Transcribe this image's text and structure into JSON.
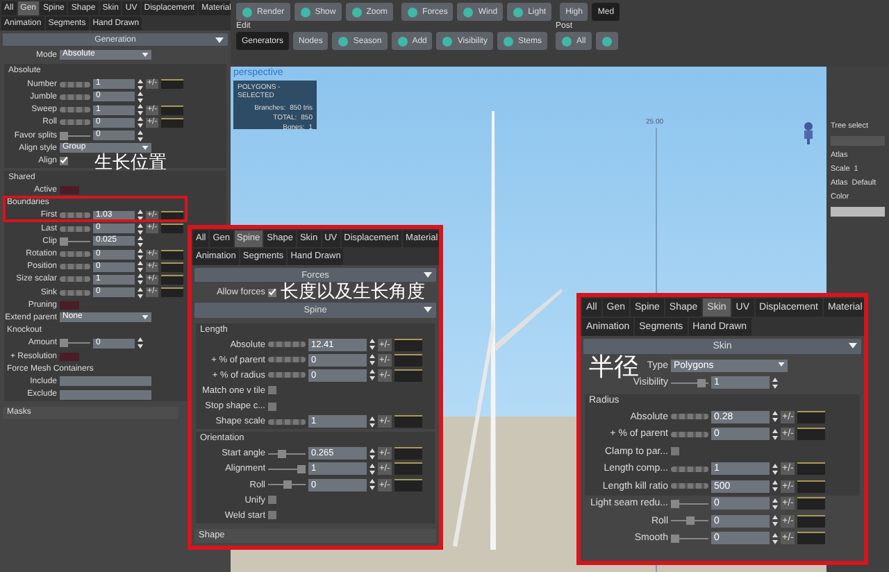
{
  "panels": [
    {
      "highlighted": false,
      "tabs": [
        [
          {
            "label": "All",
            "selected": false
          },
          {
            "label": "Gen",
            "selected": true
          },
          {
            "label": "Spine",
            "selected": false
          },
          {
            "label": "Shape",
            "selected": false
          },
          {
            "label": "Skin",
            "selected": false
          },
          {
            "label": "UV",
            "selected": false
          },
          {
            "label": "Displacement",
            "selected": false
          },
          {
            "label": "Material",
            "selected": false
          }
        ],
        [
          {
            "label": "Animation",
            "selected": false
          },
          {
            "label": "Segments",
            "selected": false
          },
          {
            "label": "Hand Drawn",
            "selected": false
          }
        ]
      ],
      "sections": [
        {
          "title": "Generation",
          "items": [
            {
              "label": "Mode",
              "kind": "dropdown",
              "value": "Absolute"
            },
            {
              "label": "Absolute",
              "kind": "group",
              "children": [
                {
                  "label": "Number",
                  "kind": "spinner",
                  "value": "1",
                  "toggle": "+/-"
                },
                {
                  "label": "Jumble",
                  "kind": "spinner",
                  "value": "0"
                },
                {
                  "label": "Sweep",
                  "kind": "spinner",
                  "value": "1",
                  "toggle": "+/-"
                },
                {
                  "label": "Roll",
                  "kind": "spinner",
                  "value": "0",
                  "toggle": "+/-"
                },
                {
                  "label": "Favor splits",
                  "kind": "slider",
                  "level": 0,
                  "value": "0"
                },
                {
                  "label": "Align style",
                  "kind": "dropdown",
                  "value": "Group"
                },
                {
                  "label": "Align",
                  "kind": "checkbox",
                  "checked": true
                }
              ]
            },
            {
              "label": "Shared",
              "kind": "group",
              "children": [
                {
                  "label": "Active",
                  "kind": "swatch"
                },
                {
                  "label": "Boundaries",
                  "kind": "heading"
                },
                {
                  "label": "First",
                  "kind": "spinner",
                  "value": "1.03",
                  "toggle": "+/-"
                },
                {
                  "label": "Last",
                  "kind": "spinner",
                  "value": "0",
                  "toggle": "+/-"
                },
                {
                  "label": "Clip",
                  "kind": "slider",
                  "level": 0,
                  "value": "0.025"
                },
                {
                  "label": "Rotation",
                  "kind": "spinner",
                  "value": "0",
                  "toggle": "+/-"
                },
                {
                  "label": "Position",
                  "kind": "spinner",
                  "value": "0",
                  "toggle": "+/-"
                },
                {
                  "label": "Size scalar",
                  "kind": "spinner",
                  "value": "1",
                  "toggle": "+/-"
                },
                {
                  "label": "Sink",
                  "kind": "spinner",
                  "value": "0",
                  "toggle": "+/-"
                },
                {
                  "label": "Pruning",
                  "kind": "swatch"
                },
                {
                  "label": "Extend parent",
                  "kind": "dropdown",
                  "value": "None"
                },
                {
                  "label": "Knockout",
                  "kind": "heading"
                },
                {
                  "label": "Amount",
                  "kind": "slider",
                  "level": 0,
                  "value": "0"
                },
                {
                  "label": "+ Resolution",
                  "kind": "swatch"
                },
                {
                  "label": "Force Mesh Containers",
                  "kind": "heading"
                },
                {
                  "label": "Include",
                  "kind": "textfield"
                },
                {
                  "label": "Exclude",
                  "kind": "textfield"
                }
              ]
            }
          ]
        }
      ],
      "footer": "Masks"
    },
    {
      "highlighted": true,
      "tabs": [
        [
          {
            "label": "All",
            "selected": false
          },
          {
            "label": "Gen",
            "selected": false
          },
          {
            "label": "Spine",
            "selected": true
          },
          {
            "label": "Shape",
            "selected": false
          },
          {
            "label": "Skin",
            "selected": false
          },
          {
            "label": "UV",
            "selected": false
          },
          {
            "label": "Displacement",
            "selected": false
          },
          {
            "label": "Material",
            "selected": false
          }
        ],
        [
          {
            "label": "Animation",
            "selected": false
          },
          {
            "label": "Segments",
            "selected": false
          },
          {
            "label": "Hand Drawn",
            "selected": false
          }
        ]
      ],
      "sections": [
        {
          "title": "Forces",
          "items": [
            {
              "label": "Allow forces",
              "kind": "checkbox",
              "checked": true
            }
          ]
        },
        {
          "title": "Spine",
          "items": [
            {
              "label": "Length",
              "kind": "group",
              "children": [
                {
                  "label": "Absolute",
                  "kind": "spinner",
                  "value": "12.41",
                  "toggle": "+/-"
                },
                {
                  "label": "+ % of parent",
                  "kind": "spinner",
                  "value": "0",
                  "toggle": "+/-"
                },
                {
                  "label": "+ % of radius",
                  "kind": "spinner",
                  "value": "0",
                  "toggle": "+/-"
                },
                {
                  "label": "Match one v tile",
                  "kind": "checkbox",
                  "checked": false
                },
                {
                  "label": "Stop shape c...",
                  "kind": "checkbox",
                  "checked": false
                },
                {
                  "label": "Shape scale",
                  "kind": "spinner",
                  "value": "1",
                  "toggle": "+/-"
                }
              ]
            },
            {
              "label": "Orientation",
              "kind": "group",
              "children": [
                {
                  "label": "Start angle",
                  "kind": "slider",
                  "level": 0.35,
                  "value": "0.265",
                  "toggle": "+/-"
                },
                {
                  "label": "Alignment",
                  "kind": "slider",
                  "level": 1,
                  "value": "1",
                  "toggle": "+/-"
                },
                {
                  "label": "Roll",
                  "kind": "slider",
                  "level": 0.5,
                  "value": "0",
                  "toggle": "+/-"
                },
                {
                  "label": "Unify",
                  "kind": "checkbox",
                  "checked": false
                },
                {
                  "label": "Weld start",
                  "kind": "checkbox",
                  "checked": false
                }
              ]
            }
          ]
        }
      ],
      "footer": "Shape"
    },
    {
      "highlighted": true,
      "tabs": [
        [
          {
            "label": "All",
            "selected": false
          },
          {
            "label": "Gen",
            "selected": false
          },
          {
            "label": "Spine",
            "selected": false
          },
          {
            "label": "Shape",
            "selected": false
          },
          {
            "label": "Skin",
            "selected": true
          },
          {
            "label": "UV",
            "selected": false
          },
          {
            "label": "Displacement",
            "selected": false
          },
          {
            "label": "Material",
            "selected": false
          }
        ],
        [
          {
            "label": "Animation",
            "selected": false
          },
          {
            "label": "Segments",
            "selected": false
          },
          {
            "label": "Hand Drawn",
            "selected": false
          }
        ]
      ],
      "sections": [
        {
          "title": "Skin",
          "items": [
            {
              "label": "Type",
              "kind": "dropdown",
              "value": "Polygons"
            },
            {
              "label": "Visibility",
              "kind": "slider",
              "level": 0.9,
              "value": "1"
            },
            {
              "label": "Radius",
              "kind": "group",
              "children": [
                {
                  "label": "Absolute",
                  "kind": "spinner",
                  "value": "0.28",
                  "toggle": "+/-"
                },
                {
                  "label": "+ % of parent",
                  "kind": "spinner",
                  "value": "0",
                  "toggle": "+/-"
                },
                {
                  "label": "Clamp to par...",
                  "kind": "checkbox",
                  "checked": false
                },
                {
                  "label": "Length comp...",
                  "kind": "spinner",
                  "value": "1",
                  "toggle": "+/-"
                },
                {
                  "label": "Length kill ratio",
                  "kind": "spinner",
                  "value": "500",
                  "toggle": "+/-"
                }
              ]
            },
            {
              "label": "Light seam redu...",
              "kind": "slider",
              "level": 0,
              "value": "0",
              "toggle": "+/-"
            },
            {
              "label": "Roll",
              "kind": "slider",
              "level": 0.5,
              "value": "0",
              "toggle": "+/-"
            },
            {
              "label": "Smooth",
              "kind": "slider",
              "level": 0,
              "value": "0",
              "toggle": "+/-"
            }
          ]
        }
      ]
    }
  ],
  "toolbar": {
    "rows": [
      {
        "groups": [
          {
            "buttons": [
              {
                "label": "Render",
                "kind": "icon_text",
                "selected": false
              },
              {
                "label": "Show",
                "kind": "icon_text",
                "selected": false
              },
              {
                "label": "Zoom",
                "kind": "icon_text",
                "selected": false
              }
            ]
          },
          {
            "buttons": [
              {
                "label": "Forces",
                "kind": "icon_text",
                "selected": false
              },
              {
                "label": "Wind",
                "kind": "icon_text",
                "selected": false
              },
              {
                "label": "Light",
                "kind": "icon_text",
                "selected": false
              }
            ]
          },
          {
            "buttons": [
              {
                "label": "High",
                "kind": "text",
                "selected": false
              },
              {
                "label": "Med",
                "kind": "text",
                "selected": true
              }
            ]
          }
        ]
      },
      {
        "groups": [
          {
            "label": "Edit",
            "buttons": [
              {
                "label": "Generators",
                "kind": "text",
                "selected": true
              },
              {
                "label": "Nodes",
                "kind": "text",
                "selected": false
              },
              {
                "label": "Season",
                "kind": "icon_text",
                "selected": false
              },
              {
                "label": "Add",
                "kind": "icon_text",
                "selected": false
              },
              {
                "label": "Visibility",
                "kind": "icon_text",
                "selected": false
              },
              {
                "label": "Stems",
                "kind": "icon_text",
                "selected": false
              }
            ]
          },
          {
            "label": "Post",
            "buttons": [
              {
                "label": "All",
                "kind": "icon_text",
                "selected": false
              },
              {
                "kind": "icon",
                "selected": false
              }
            ]
          }
        ]
      }
    ]
  },
  "viewport": {
    "label": "perspective",
    "stats": {
      "title": "POLYGONS - SELECTED",
      "lines": [
        {
          "name": "Branches:",
          "value": "850 tris"
        },
        {
          "name": "TOTAL:",
          "value": "850"
        },
        {
          "name": "Bones:",
          "value": "1"
        }
      ]
    },
    "grid_label": "25.00"
  },
  "right_panel": {
    "items": [
      {
        "kind": "label",
        "text": "Tree select"
      },
      {
        "kind": "field"
      },
      {
        "kind": "label",
        "text": "Atlas"
      },
      {
        "kind": "pair",
        "name": "Scale",
        "value": "1"
      },
      {
        "kind": "pair",
        "name": "Atlas",
        "value": "Default"
      },
      {
        "kind": "label",
        "text": "Color"
      },
      {
        "kind": "field"
      }
    ]
  },
  "annotations": [
    {
      "text": "生长位置"
    },
    {
      "text": "长度以及生长角度"
    },
    {
      "text": "半径"
    }
  ]
}
